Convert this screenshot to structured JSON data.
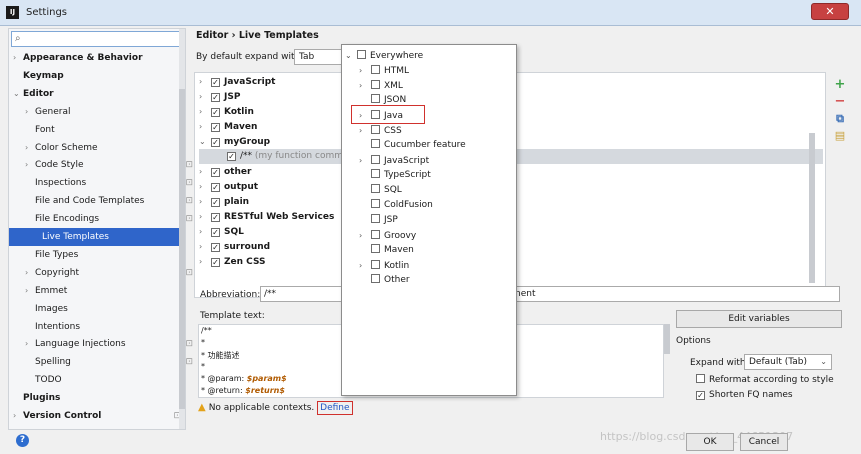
{
  "window": {
    "title": "Settings",
    "app_icon": "IJ",
    "close_label": "✕"
  },
  "sidebar": {
    "search_placeholder": "",
    "items": [
      {
        "label": "Appearance & Behavior",
        "arrow": "›",
        "bold": true
      },
      {
        "label": "Keymap",
        "arrow": "",
        "bold": true
      },
      {
        "label": "Editor",
        "arrow": "⌄",
        "bold": true
      },
      {
        "label": "General",
        "arrow": "›"
      },
      {
        "label": "Font",
        "arrow": ""
      },
      {
        "label": "Color Scheme",
        "arrow": "›"
      },
      {
        "label": "Code Style",
        "arrow": "›"
      },
      {
        "label": "Inspections",
        "arrow": ""
      },
      {
        "label": "File and Code Templates",
        "arrow": ""
      },
      {
        "label": "File Encodings",
        "arrow": ""
      },
      {
        "label": "Live Templates",
        "arrow": "",
        "selected": true
      },
      {
        "label": "File Types",
        "arrow": ""
      },
      {
        "label": "Copyright",
        "arrow": "›"
      },
      {
        "label": "Emmet",
        "arrow": "›"
      },
      {
        "label": "Images",
        "arrow": ""
      },
      {
        "label": "Intentions",
        "arrow": ""
      },
      {
        "label": "Language Injections",
        "arrow": "›"
      },
      {
        "label": "Spelling",
        "arrow": ""
      },
      {
        "label": "TODO",
        "arrow": ""
      },
      {
        "label": "Plugins",
        "arrow": "",
        "bold": true
      },
      {
        "label": "Version Control",
        "arrow": "›",
        "bold": true
      }
    ]
  },
  "main": {
    "breadcrumb": "Editor › Live Templates",
    "expand_label": "By default expand with",
    "expand_value": "Tab",
    "template_groups": [
      {
        "label": "JavaScript",
        "arrow": "›",
        "checked": true
      },
      {
        "label": "JSP",
        "arrow": "›",
        "checked": true
      },
      {
        "label": "Kotlin",
        "arrow": "›",
        "checked": true
      },
      {
        "label": "Maven",
        "arrow": "›",
        "checked": true
      },
      {
        "label": "myGroup",
        "arrow": "⌄",
        "checked": true
      },
      {
        "label": "/**",
        "arrow": "",
        "checked": true,
        "child": true,
        "desc": "(my function comment)"
      },
      {
        "label": "other",
        "arrow": "›",
        "checked": true
      },
      {
        "label": "output",
        "arrow": "›",
        "checked": true
      },
      {
        "label": "plain",
        "arrow": "›",
        "checked": true
      },
      {
        "label": "RESTful Web Services",
        "arrow": "›",
        "checked": true
      },
      {
        "label": "SQL",
        "arrow": "›",
        "checked": true
      },
      {
        "label": "surround",
        "arrow": "›",
        "checked": true
      },
      {
        "label": "Zen CSS",
        "arrow": "›",
        "checked": true
      }
    ],
    "abbreviation_label": "Abbreviation:",
    "abbreviation_value": "/**",
    "description_value": "nent",
    "template_text_label": "Template text:",
    "template_lines": [
      {
        "text": "/**"
      },
      {
        "text": "*"
      },
      {
        "text": "* 功能描述"
      },
      {
        "text": "*"
      },
      {
        "prefix": "* @param: ",
        "var": "$param$"
      },
      {
        "prefix": "* @return: ",
        "var": "$return$"
      }
    ],
    "edit_variables_label": "Edit variables",
    "options_label": "Options",
    "expand_with_label": "Expand with",
    "expand_with_value": "Default (Tab)",
    "reformat_label": "Reformat according to style",
    "reformat_checked": false,
    "shorten_label": "Shorten FQ names",
    "shorten_checked": true,
    "warning_text": "No applicable contexts.",
    "define_label": "Define"
  },
  "context_popup": {
    "items": [
      {
        "label": "Everywhere",
        "arrow": "⌄",
        "indent": 0
      },
      {
        "label": "HTML",
        "arrow": "›",
        "indent": 1
      },
      {
        "label": "XML",
        "arrow": "›",
        "indent": 1
      },
      {
        "label": "JSON",
        "arrow": "",
        "indent": 1
      },
      {
        "label": "Java",
        "arrow": "›",
        "indent": 1,
        "highlight": true
      },
      {
        "label": "CSS",
        "arrow": "›",
        "indent": 1
      },
      {
        "label": "Cucumber feature",
        "arrow": "",
        "indent": 1
      },
      {
        "label": "JavaScript",
        "arrow": "›",
        "indent": 1
      },
      {
        "label": "TypeScript",
        "arrow": "",
        "indent": 1
      },
      {
        "label": "SQL",
        "arrow": "",
        "indent": 1
      },
      {
        "label": "ColdFusion",
        "arrow": "",
        "indent": 1
      },
      {
        "label": "JSP",
        "arrow": "",
        "indent": 1
      },
      {
        "label": "Groovy",
        "arrow": "›",
        "indent": 1
      },
      {
        "label": "Maven",
        "arrow": "",
        "indent": 1
      },
      {
        "label": "Kotlin",
        "arrow": "›",
        "indent": 1
      },
      {
        "label": "Other",
        "arrow": "",
        "indent": 1
      }
    ]
  },
  "footer": {
    "ok_label": "OK",
    "cancel_label": "Cancel",
    "watermark": "https://blog.csdn.net/qq_44651307"
  },
  "colors": {
    "selection": "#2f65ca",
    "link": "#2459c6",
    "highlight_box": "#d0312d"
  }
}
